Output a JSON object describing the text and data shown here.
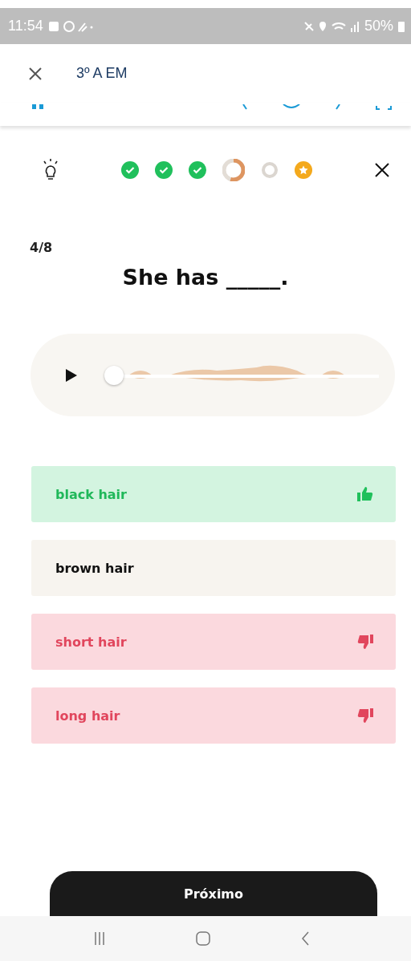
{
  "status_bar": {
    "time": "11:54",
    "battery": "50%"
  },
  "header": {
    "title": "3º A EM"
  },
  "steps": [
    {
      "kind": "done"
    },
    {
      "kind": "done"
    },
    {
      "kind": "done"
    },
    {
      "kind": "current"
    },
    {
      "kind": "todo"
    },
    {
      "kind": "star"
    }
  ],
  "counter": "4/8",
  "question": "She has _____.",
  "audio": {
    "level": 0
  },
  "options": [
    {
      "label": "black hair",
      "correct": true,
      "wrong": false
    },
    {
      "label": "brown hair",
      "correct": false,
      "wrong": false
    },
    {
      "label": "short hair",
      "correct": false,
      "wrong": true
    },
    {
      "label": "long hair",
      "correct": false,
      "wrong": true
    }
  ],
  "next_button": "Próximo"
}
